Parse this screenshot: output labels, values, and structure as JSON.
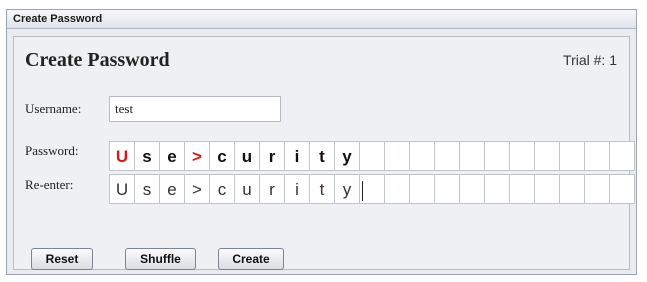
{
  "window": {
    "title": "Create Password"
  },
  "panel": {
    "heading": "Create Password",
    "trial": "Trial #: 1"
  },
  "form": {
    "username_label": "Username:",
    "username_value": "test",
    "password_label": "Password:",
    "reenter_label": "Re-enter:"
  },
  "password_chars": [
    {
      "char": "U",
      "highlight": true
    },
    {
      "char": "s",
      "highlight": false
    },
    {
      "char": "e",
      "highlight": false
    },
    {
      "char": ">",
      "highlight": true
    },
    {
      "char": "c",
      "highlight": false
    },
    {
      "char": "u",
      "highlight": false
    },
    {
      "char": "r",
      "highlight": false
    },
    {
      "char": "i",
      "highlight": false
    },
    {
      "char": "t",
      "highlight": false
    },
    {
      "char": "y",
      "highlight": false
    }
  ],
  "reenter_chars": [
    "U",
    "s",
    "e",
    ">",
    "c",
    "u",
    "r",
    "i",
    "t",
    "y"
  ],
  "grid": {
    "total_cells": 21,
    "reenter_caret_at": 10
  },
  "buttons": {
    "reset": "Reset",
    "shuffle": "Shuffle",
    "create": "Create"
  },
  "colors": {
    "highlight": "#d81818"
  }
}
